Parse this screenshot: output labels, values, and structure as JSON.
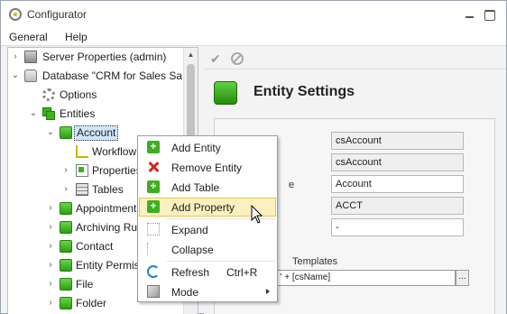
{
  "window": {
    "title": "Configurator"
  },
  "menubar": {
    "items": [
      "General",
      "Help"
    ]
  },
  "tree": {
    "items": [
      {
        "label": "Server Properties (admin)",
        "icon": "server-icon",
        "expander": "collapsed"
      },
      {
        "label": "Database \"CRM for Sales Sa...",
        "icon": "database-icon",
        "expander": "expanded"
      },
      {
        "label": "Options",
        "icon": "gear-icon",
        "expander": "none"
      },
      {
        "label": "Entities",
        "icon": "entities-icon",
        "expander": "expanded"
      },
      {
        "label": "Account",
        "icon": "entity-icon",
        "expander": "expanded",
        "selected": true
      },
      {
        "label": "Workflow",
        "icon": "workflow-icon",
        "expander": "none"
      },
      {
        "label": "Properties",
        "icon": "properties-icon",
        "expander": "collapsed"
      },
      {
        "label": "Tables",
        "icon": "table-icon",
        "expander": "collapsed"
      },
      {
        "label": "Appointment",
        "icon": "entity-icon",
        "expander": "collapsed"
      },
      {
        "label": "Archiving Rule",
        "icon": "entity-icon",
        "expander": "collapsed"
      },
      {
        "label": "Contact",
        "icon": "entity-icon",
        "expander": "collapsed"
      },
      {
        "label": "Entity Permissi",
        "icon": "entity-icon",
        "expander": "collapsed"
      },
      {
        "label": "File",
        "icon": "entity-icon",
        "expander": "collapsed"
      },
      {
        "label": "Folder",
        "icon": "entity-icon",
        "expander": "collapsed"
      }
    ]
  },
  "entity_settings": {
    "title": "Entity Settings",
    "fields": [
      {
        "value": "csAccount",
        "readonly": true
      },
      {
        "value": "csAccount",
        "readonly": true
      },
      {
        "value": "Account",
        "readonly": false
      },
      {
        "value": "ACCT",
        "readonly": true
      },
      {
        "value": "-",
        "readonly": false
      }
    ],
    "partial_label_e": "e",
    "partial_label_templates": "Templates",
    "expression": "( + [Code] + ') ' + [csName]",
    "expression_button": "..."
  },
  "context_menu": {
    "items": [
      {
        "label": "Add Entity",
        "icon": "add-icon"
      },
      {
        "label": "Remove Entity",
        "icon": "remove-icon"
      },
      {
        "label": "Add Table",
        "icon": "add-icon"
      },
      {
        "label": "Add Property",
        "icon": "add-icon",
        "highlighted": true
      },
      {
        "label": "Expand",
        "icon": "expand-icon"
      },
      {
        "label": "Collapse",
        "icon": "collapse-icon"
      },
      {
        "label": "Refresh",
        "icon": "refresh-icon",
        "shortcut": "Ctrl+R"
      },
      {
        "label": "Mode",
        "icon": "mode-icon",
        "submenu": true
      }
    ]
  },
  "colors": {
    "accent_green": "#3fae22",
    "highlight": "#fbf1c0",
    "selection": "#cfe6fb"
  }
}
